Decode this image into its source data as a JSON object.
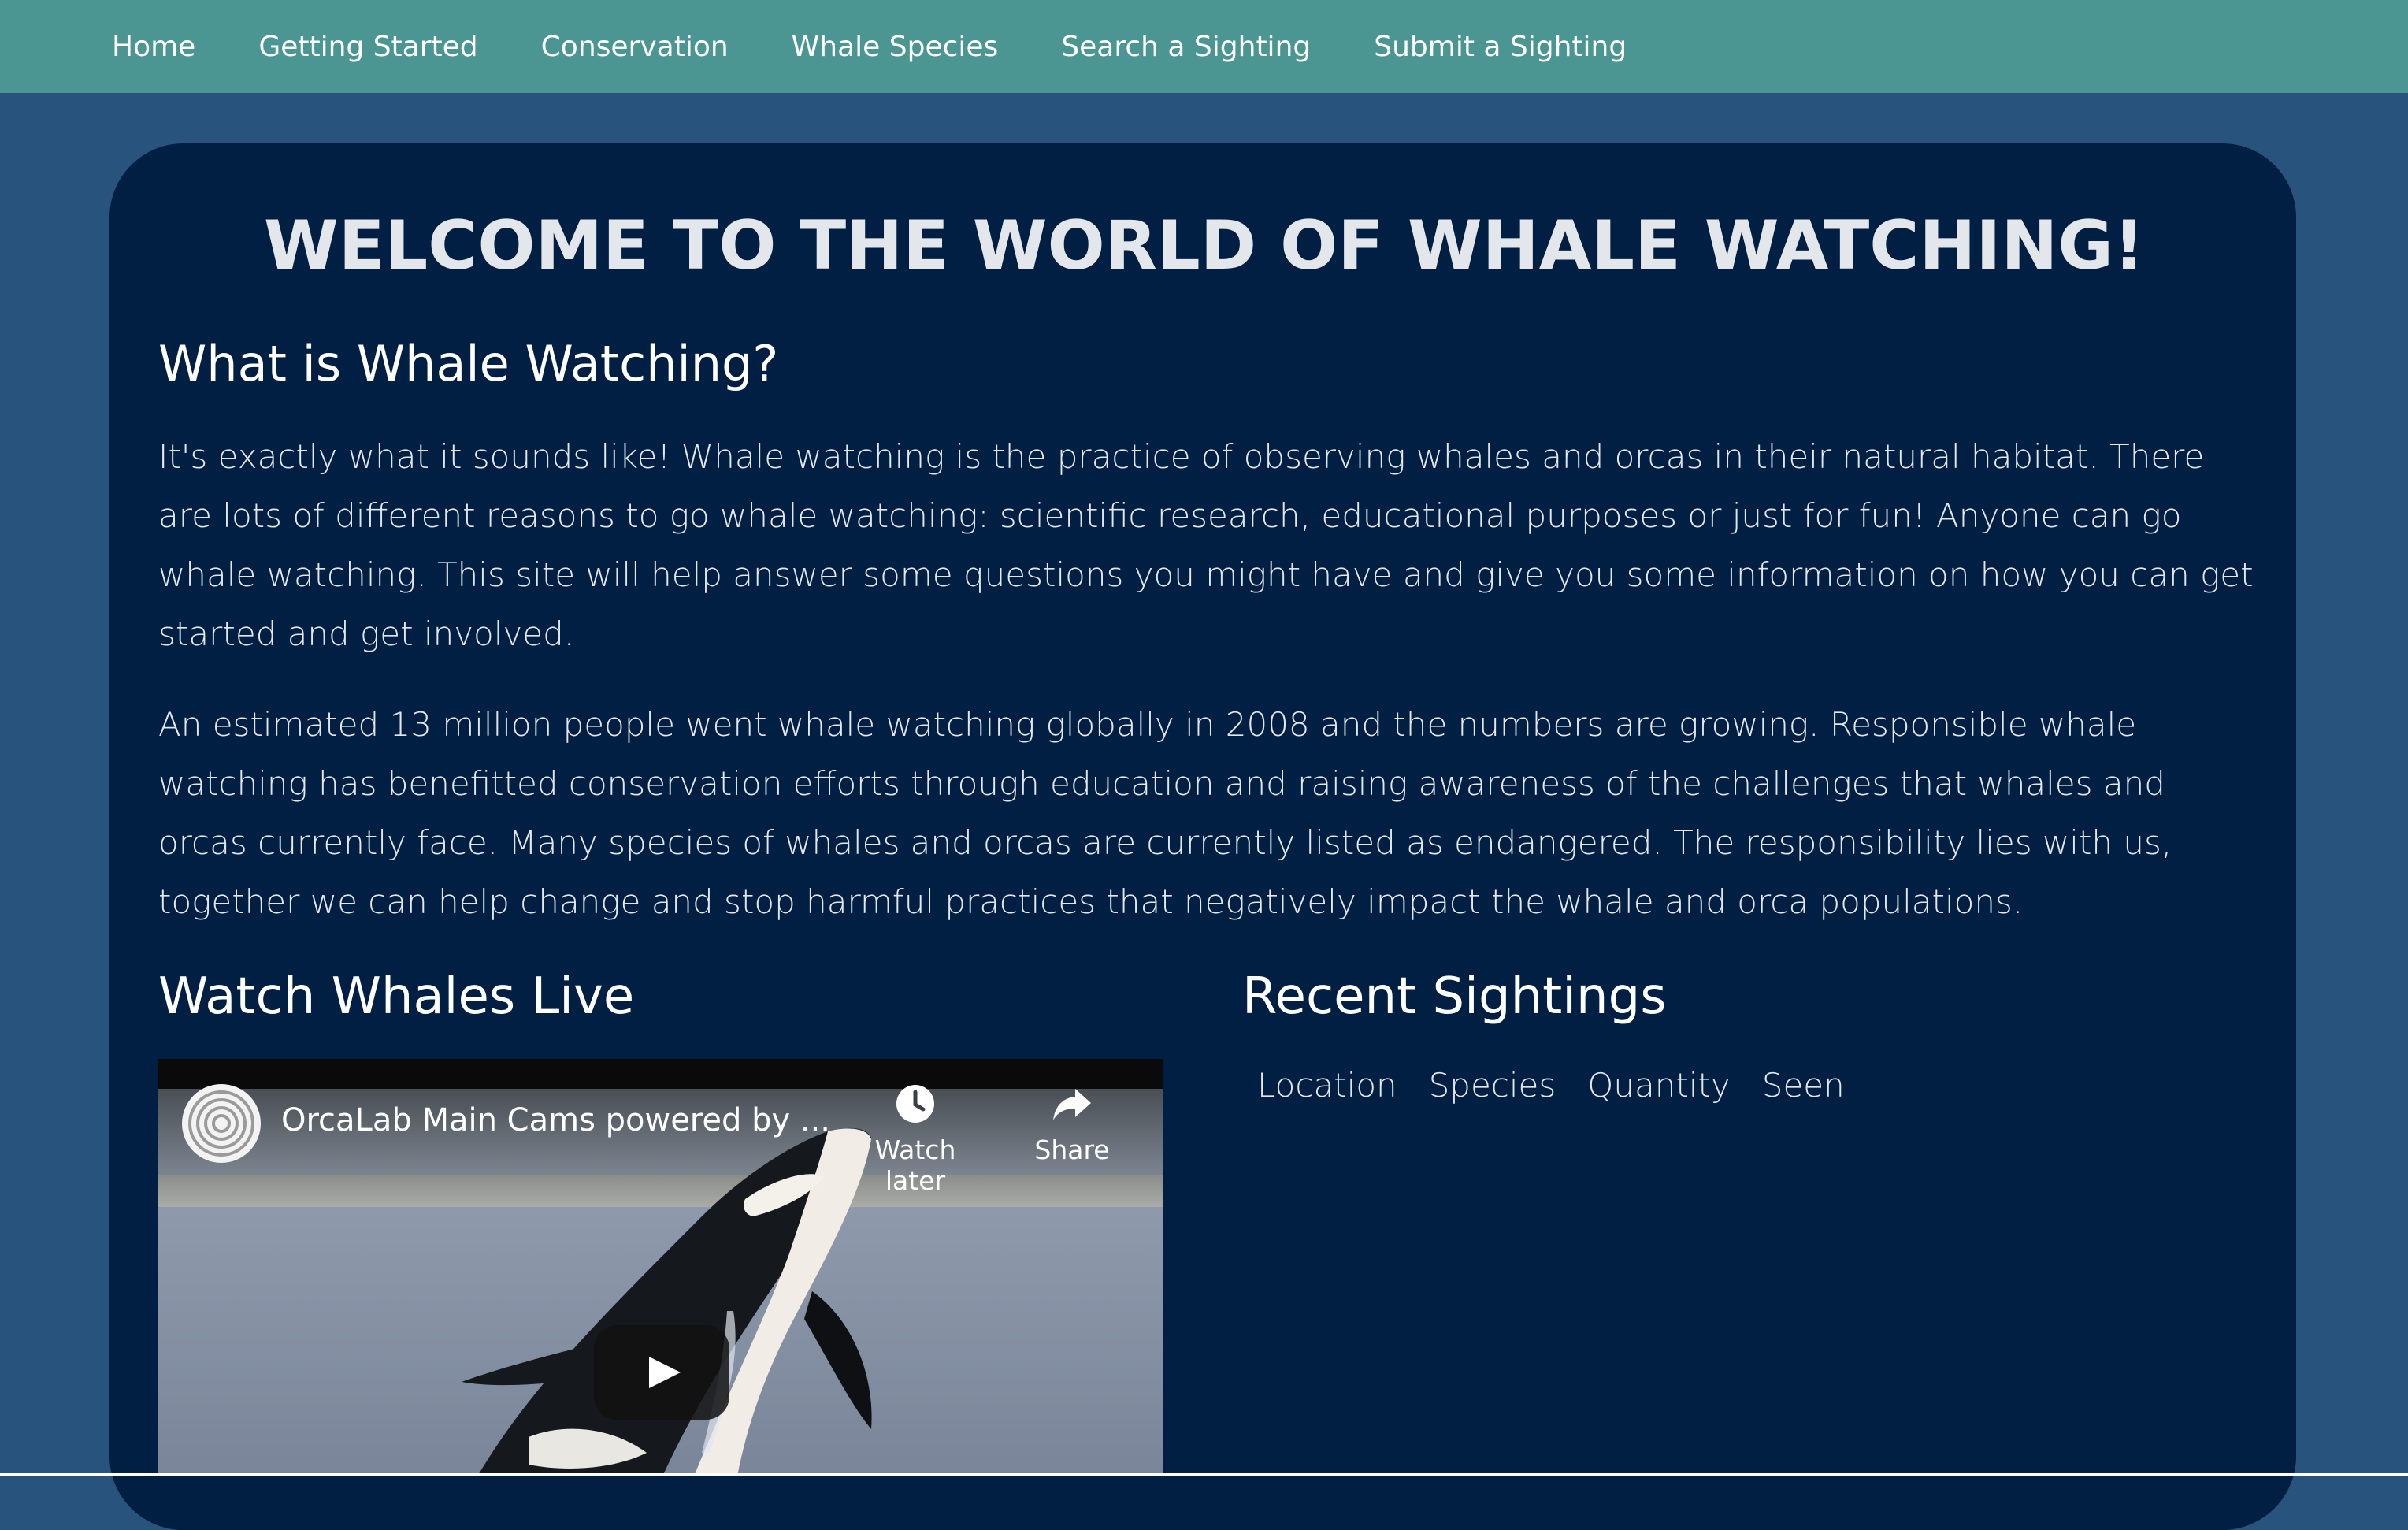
{
  "nav": {
    "items": [
      {
        "label": "Home"
      },
      {
        "label": "Getting Started"
      },
      {
        "label": "Conservation"
      },
      {
        "label": "Whale Species"
      },
      {
        "label": "Search a Sighting"
      },
      {
        "label": "Submit a Sighting"
      }
    ]
  },
  "main": {
    "welcome_title": "Welcome to the World of Whale Watching!",
    "what_heading": "What is Whale Watching?",
    "paragraph_1": "It's exactly what it sounds like! Whale watching is the practice of observing whales and orcas in their natural habitat. There are lots of different reasons to go whale watching: scientific research, educational purposes or just for fun! Anyone can go whale watching. This site will help answer some questions you might have and give you some information on how you can get started and get involved.",
    "paragraph_2": "An estimated 13 million people went whale watching globally in 2008 and the numbers are growing. Responsible whale watching has benefitted conservation efforts through education and raising awareness of the challenges that whales and orcas currently face. Many species of whales and orcas are currently listed as endangered. The responsibility lies with us, together we can help change and stop harmful practices that negatively impact the whale and orca populations.",
    "watch_heading": "Watch Whales Live",
    "recent_heading": "Recent Sightings"
  },
  "video": {
    "title": "OrcaLab Main Cams powered by ...",
    "watch_later_label": "Watch later",
    "share_label": "Share",
    "icons": {
      "channel": "channel-logo-icon",
      "clock": "clock-icon",
      "share": "share-arrow-icon",
      "play": "play-icon"
    }
  },
  "sightings_table": {
    "columns": [
      "Location",
      "Species",
      "Quantity",
      "Seen"
    ]
  },
  "colors": {
    "page_background": "#28537d",
    "navbar": "#4b9693",
    "card": "#001f42",
    "text": "#ffffff"
  }
}
